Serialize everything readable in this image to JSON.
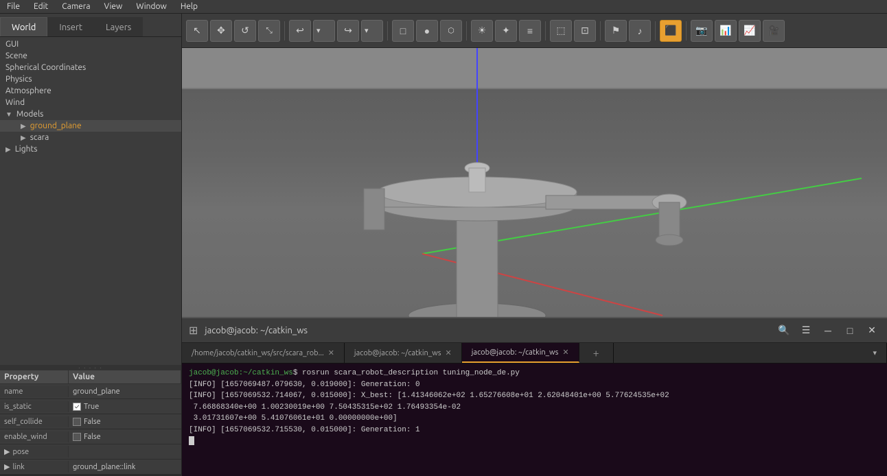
{
  "menubar": {
    "items": [
      "File",
      "Edit",
      "Camera",
      "View",
      "Window",
      "Help"
    ]
  },
  "tabs": {
    "world": "World",
    "insert": "Insert",
    "layers": "Layers"
  },
  "tree": {
    "items": [
      {
        "label": "GUI",
        "indent": 0,
        "type": "leaf"
      },
      {
        "label": "Scene",
        "indent": 0,
        "type": "leaf"
      },
      {
        "label": "Spherical Coordinates",
        "indent": 0,
        "type": "leaf"
      },
      {
        "label": "Physics",
        "indent": 0,
        "type": "leaf"
      },
      {
        "label": "Atmosphere",
        "indent": 0,
        "type": "leaf"
      },
      {
        "label": "Wind",
        "indent": 0,
        "type": "leaf"
      },
      {
        "label": "Models",
        "indent": 0,
        "type": "collapsible",
        "expanded": true
      },
      {
        "label": "ground_plane",
        "indent": 1,
        "type": "collapsible",
        "expanded": true,
        "color": "orange"
      },
      {
        "label": "scara",
        "indent": 1,
        "type": "collapsible",
        "expanded": false
      },
      {
        "label": "Lights",
        "indent": 0,
        "type": "collapsible",
        "expanded": false
      }
    ]
  },
  "properties": {
    "header": {
      "name": "Property",
      "value": "Value"
    },
    "rows": [
      {
        "name": "name",
        "value": "ground_plane",
        "type": "text"
      },
      {
        "name": "is_static",
        "value": "True",
        "type": "checkbox",
        "checked": true
      },
      {
        "name": "self_collide",
        "value": "False",
        "type": "checkbox",
        "checked": false
      },
      {
        "name": "enable_wind",
        "value": "False",
        "type": "checkbox",
        "checked": false
      },
      {
        "name": "pose",
        "value": "",
        "type": "collapsible"
      },
      {
        "name": "link",
        "value": "ground_plane::link",
        "type": "collapsible"
      }
    ]
  },
  "toolbar": {
    "buttons": [
      {
        "icon": "↖",
        "name": "select-tool",
        "active": false
      },
      {
        "icon": "✥",
        "name": "translate-tool",
        "active": false
      },
      {
        "icon": "↺",
        "name": "rotate-tool",
        "active": false
      },
      {
        "icon": "⤡",
        "name": "scale-tool",
        "active": false
      },
      {
        "icon": "↩",
        "name": "undo-tool",
        "active": false
      },
      {
        "icon": "↪",
        "name": "redo-tool",
        "active": false
      },
      {
        "icon": "□",
        "name": "box-shape",
        "active": false
      },
      {
        "icon": "○",
        "name": "sphere-shape",
        "active": false
      },
      {
        "icon": "⬡",
        "name": "cylinder-shape",
        "active": false
      },
      {
        "icon": "☀",
        "name": "point-light",
        "active": false
      },
      {
        "icon": "✦",
        "name": "spot-light",
        "active": false
      },
      {
        "icon": "≡",
        "name": "dir-light",
        "active": false
      },
      {
        "icon": "⬚",
        "name": "copy",
        "active": false
      },
      {
        "icon": "⬛",
        "name": "paste",
        "active": false
      },
      {
        "icon": "⚑",
        "name": "flag",
        "active": false
      },
      {
        "icon": "♪",
        "name": "audio",
        "active": false
      },
      {
        "icon": "⬛",
        "name": "active-btn",
        "active": true
      },
      {
        "icon": "📷",
        "name": "screenshot",
        "active": false
      },
      {
        "icon": "📊",
        "name": "log",
        "active": false
      },
      {
        "icon": "📈",
        "name": "plot",
        "active": false
      },
      {
        "icon": "🎥",
        "name": "record",
        "active": false
      }
    ]
  },
  "terminal": {
    "title": "jacob@jacob: ~/catkin_ws",
    "tabs": [
      {
        "label": "/home/jacob/catkin_ws/src/scara_rob...",
        "active": false,
        "closeable": true
      },
      {
        "label": "jacob@jacob: ~/catkin_ws",
        "active": false,
        "closeable": true
      },
      {
        "label": "jacob@jacob: ~/catkin_ws",
        "active": true,
        "closeable": true
      }
    ],
    "output": [
      {
        "text": "jacob@jacob:~/catkin_ws$ rosrun scara_robot_description tuning_node_de.py",
        "type": "prompt"
      },
      {
        "text": "[INFO] [1657069487.079630, 0.019000]: Generation: 0",
        "type": "info"
      },
      {
        "text": "[INFO] [1657069532.714067, 0.015000]: X_best: [1.41346062e+02 1.65276608e+01 2.62048401e+00 5.77624535e+02",
        "type": "info"
      },
      {
        "text": " 7.66868340e+00 1.00230019e+00 7.50435315e+02 1.76493354e-02",
        "type": "info"
      },
      {
        "text": " 3.01731607e+00 5.41076061e+01 0.00000000e+00]",
        "type": "info"
      },
      {
        "text": "[INFO] [1657069532.715530, 0.015000]: Generation: 1",
        "type": "info"
      }
    ]
  }
}
